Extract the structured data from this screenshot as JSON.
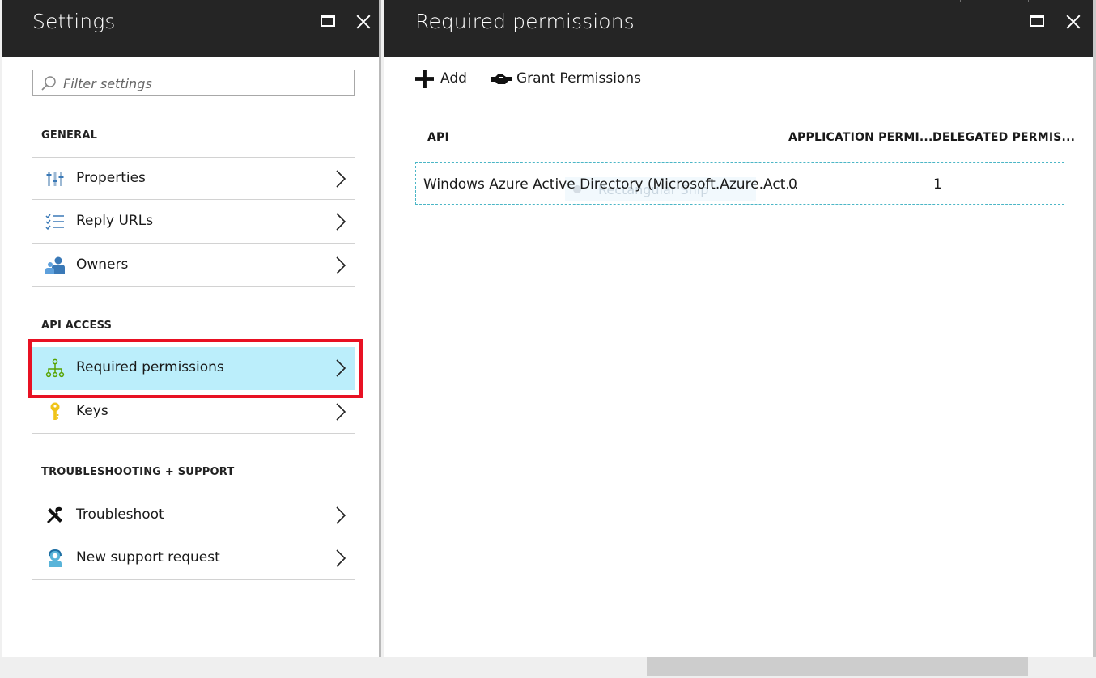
{
  "settings_blade": {
    "title": "Settings",
    "filter_placeholder": "Filter settings",
    "sections": [
      {
        "label": "GENERAL",
        "items": [
          {
            "label": "Properties",
            "icon": "properties-icon"
          },
          {
            "label": "Reply URLs",
            "icon": "list-icon"
          },
          {
            "label": "Owners",
            "icon": "owners-icon"
          }
        ]
      },
      {
        "label": "API ACCESS",
        "items": [
          {
            "label": "Required permissions",
            "icon": "hierarchy-icon",
            "selected": true
          },
          {
            "label": "Keys",
            "icon": "key-icon"
          }
        ]
      },
      {
        "label": "TROUBLESHOOTING + SUPPORT",
        "items": [
          {
            "label": "Troubleshoot",
            "icon": "tools-icon"
          },
          {
            "label": "New support request",
            "icon": "support-icon"
          }
        ]
      }
    ]
  },
  "permissions_blade": {
    "title": "Required permissions",
    "toolbar": {
      "add_label": "Add",
      "grant_label": "Grant Permissions"
    },
    "table": {
      "columns": [
        "API",
        "APPLICATION PERMI...",
        "DELEGATED PERMIS..."
      ],
      "rows": [
        [
          "Windows Azure Active Directory (Microsoft.Azure.Act...",
          "0",
          "1"
        ]
      ]
    },
    "overlay_text": "Rectangular Snip"
  },
  "colors": {
    "header": "#252525",
    "selected_item": "#bbeefb",
    "highlight_border": "#e81123",
    "row_border": "#4bb6c6"
  }
}
